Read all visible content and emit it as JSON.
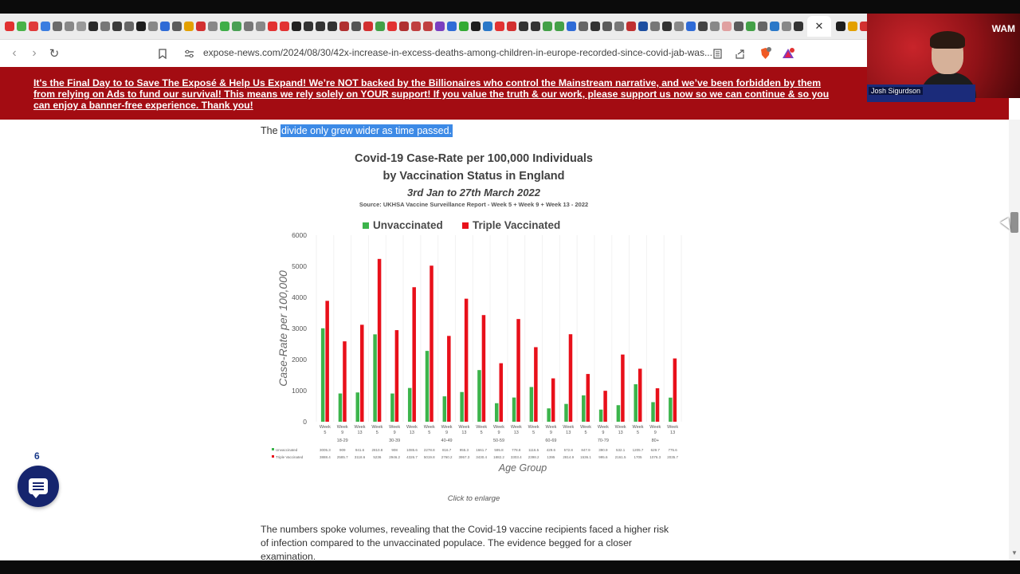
{
  "browser": {
    "url": "expose-news.com/2024/08/30/42x-increase-in-excess-deaths-among-children-in-europe-recorded-since-covid-jab-was...",
    "close_tab_label": "✕",
    "tab_favicon_colors": [
      "#e03030",
      "#49b248",
      "#e03a3a",
      "#3b7de0",
      "#6b6b6b",
      "#888",
      "#999",
      "#2a2a2a",
      "#777",
      "#3b3b3b",
      "#666",
      "#1d1d1d",
      "#888",
      "#2f6bd6",
      "#5b5b5b",
      "#e3a000",
      "#d23030",
      "#888",
      "#3fae48",
      "#4aa055",
      "#777",
      "#888",
      "#e23232",
      "#e23232",
      "#222",
      "#333",
      "#333",
      "#333",
      "#b03030",
      "#555",
      "#d23030",
      "#43a047",
      "#e23232",
      "#b03030",
      "#c04040",
      "#c04040",
      "#7a3fc0",
      "#2f6bd6",
      "#33aa33",
      "#1d1d1d",
      "#2a78c8",
      "#e23232",
      "#d23030",
      "#333",
      "#333",
      "#43a047",
      "#43a047",
      "#2f6bd6",
      "#666",
      "#333",
      "#5b5b5b",
      "#777",
      "#c03030",
      "#1d4ea0",
      "#777",
      "#333",
      "#888",
      "#2f6bd6",
      "#444",
      "#888",
      "#e0a0a0",
      "#5b5b5b",
      "#43a047",
      "#666",
      "#2a78c8",
      "#888",
      "#333",
      "#1d1d1d",
      "#e3a000",
      "#d23030",
      "#888",
      "#e23232"
    ]
  },
  "banner": {
    "text": "It's the Final Day to to Save The Exposé & Help Us Expand! We’re NOT backed by the Billionaires who control the Mainstream narrative, and we’ve been forbidden by them from relying on Ads to fund our survival! This means we rely solely on YOUR support! If you value the truth & our work, please support us now so we can continue & so you can enjoy a banner-free experience. Thank you!"
  },
  "webcam": {
    "name_tag": "Josh Sigurdson",
    "logo": "WAM"
  },
  "article": {
    "intro_prefix": "The ",
    "intro_highlight": "divide only grew wider as time passed.",
    "caption": "Click to enlarge",
    "paragraph": "The numbers spoke volumes, revealing that the Covid-19 vaccine recipients faced a higher risk of infection compared to the unvaccinated populace. The evidence begged for a closer examination."
  },
  "chat_widget": {
    "count": "6"
  },
  "chart_data": {
    "type": "bar",
    "title_line1": "Covid-19 Case-Rate per 100,000 Individuals",
    "title_line2": "by Vaccination Status in England",
    "subtitle": "3rd Jan to 27th March 2022",
    "source": "Source: UKHSA Vaccine Surveillance Report - Week 5 + Week 9 + Week 13 - 2022",
    "ylabel": "Case-Rate per 100,000",
    "xlabel": "Age Group",
    "ylim": [
      0,
      6000
    ],
    "yticks": [
      "6000",
      "5000",
      "4000",
      "3000",
      "2000",
      "1000",
      "0"
    ],
    "categories": [
      "Week 5",
      "Week 9",
      "Week 13",
      "Week 5",
      "Week 9",
      "Week 13",
      "Week 5",
      "Week 9",
      "Week 13",
      "Week 5",
      "Week 9",
      "Week 13",
      "Week 5",
      "Week 9",
      "Week 13",
      "Week 5",
      "Week 9",
      "Week 13",
      "Week 5",
      "Week 9",
      "Week 13"
    ],
    "age_groups": [
      "18-29",
      "30-39",
      "40-49",
      "50-59",
      "60-69",
      "70-79",
      "80+"
    ],
    "series": [
      {
        "name": "Unvaccinated",
        "color": "#3cb44b",
        "values": [
          3005.3,
          909,
          941.6,
          2810.8,
          908,
          1085.6,
          2278.8,
          816.7,
          955.3,
          1661.7,
          595.8,
          778.8,
          1116.5,
          429.6,
          572.8,
          847.9,
          390.9,
          532.1,
          1205.7,
          629.7,
          775.6
        ],
        "labels": [
          "3005.3",
          "909",
          "941.6",
          "2810.8",
          "908",
          "1085.6",
          "2278.8",
          "816.7",
          "955.3",
          "1661.7",
          "595.8",
          "778.8",
          "1116.5",
          "429.6",
          "572.8",
          "847.9",
          "390.9",
          "532.1",
          "1205.7",
          "629.7",
          "775.6"
        ]
      },
      {
        "name": "Triple Vaccinated",
        "color": "#e8101a",
        "values": [
          3888.4,
          2585.7,
          3118.6,
          5236,
          2946.2,
          4326.7,
          5019.8,
          2760.2,
          3957.3,
          3430.4,
          1882.2,
          3303.4,
          2398.2,
          1395,
          2814.9,
          1536.1,
          995.6,
          2161.5,
          1705,
          1076.3,
          2035.7
        ],
        "labels": [
          "3888.4",
          "2585.7",
          "3118.6",
          "5236",
          "2946.2",
          "4326.7",
          "5019.8",
          "2760.2",
          "3957.3",
          "3430.4",
          "1882.2",
          "3303.4",
          "2398.2",
          "1395",
          "2814.9",
          "1536.1",
          "995.6",
          "2161.5",
          "1705",
          "1076.3",
          "2035.7"
        ]
      }
    ],
    "legend_position": "top",
    "grid": false
  }
}
